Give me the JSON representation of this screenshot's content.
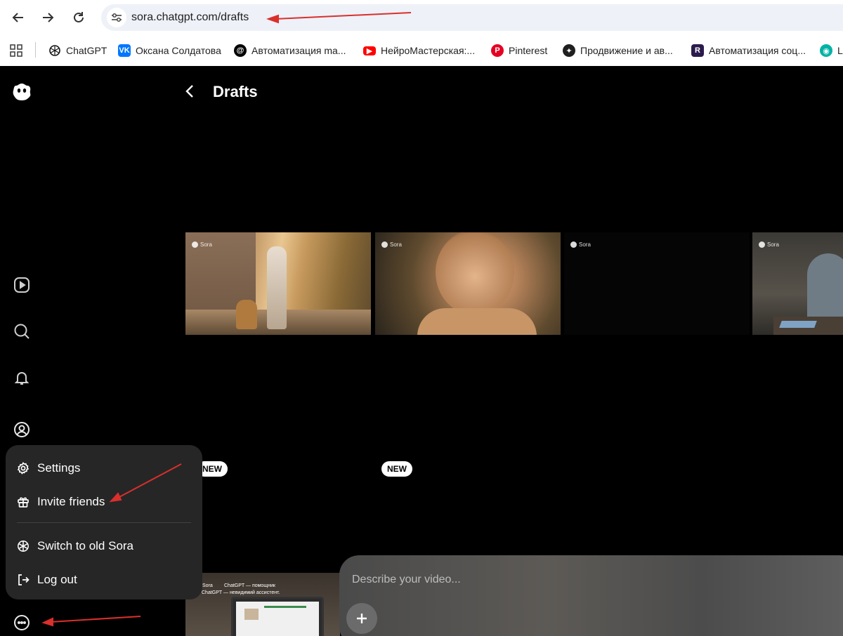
{
  "browser": {
    "url": "sora.chatgpt.com/drafts",
    "bookmarks": [
      {
        "label": "ChatGPT",
        "icon": "chatgpt-icon",
        "color": "#ffffff"
      },
      {
        "label": "Оксана Солдатова",
        "icon": "vk-icon",
        "color": "#0077ff"
      },
      {
        "label": "Автоматизация ma...",
        "icon": "threads-icon",
        "color": "#000000"
      },
      {
        "label": "НейроМастерская:...",
        "icon": "youtube-icon",
        "color": "#ff0000"
      },
      {
        "label": "Pinterest",
        "icon": "pinterest-icon",
        "color": "#e60023"
      },
      {
        "label": "Продвижение и ав...",
        "icon": "sparkle-icon",
        "color": "#1f1f1f"
      },
      {
        "label": "Автоматизация соц...",
        "icon": "r-logo-icon",
        "color": "#2b1b4d"
      },
      {
        "label": "L",
        "icon": "eye-icon",
        "color": "#00b3a4"
      }
    ]
  },
  "page": {
    "title": "Drafts"
  },
  "thumbnails": [
    {
      "badge": "Sora",
      "scene": "woman-walking-dog"
    },
    {
      "badge": "Sora",
      "scene": "smiling-woman"
    },
    {
      "badge": "Sora",
      "scene": "dark"
    },
    {
      "badge": "Sora",
      "scene": "man-at-table"
    }
  ],
  "new_badges": [
    "NEW",
    "NEW"
  ],
  "prompt": {
    "placeholder": "Describe your video..."
  },
  "menu": {
    "items": [
      {
        "label": "Settings",
        "icon": "gear-icon"
      },
      {
        "label": "Invite friends",
        "icon": "gift-icon"
      },
      {
        "label": "Switch to old Sora",
        "icon": "openai-icon"
      },
      {
        "label": "Log out",
        "icon": "logout-icon"
      }
    ]
  },
  "bottom_thumb": {
    "badge": "Sora",
    "line1": "ChatGPT — помощник",
    "line2": "ChatGPT — невидимий ассистент."
  },
  "colors": {
    "annotation_arrow": "#d9302c",
    "menu_bg": "#262626"
  }
}
